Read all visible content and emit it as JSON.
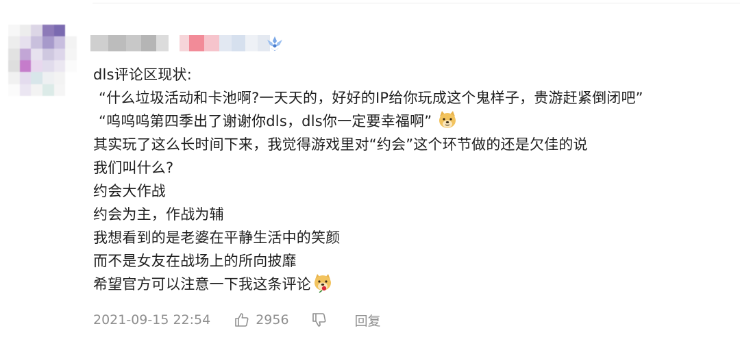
{
  "comment": {
    "lines": [
      "dls评论区现状:",
      "“什么垃圾活动和卡池啊?一天天的，好好的IP给你玩成这个鬼样子，贵游赶紧倒闭吧”",
      "“呜呜呜第四季出了谢谢你dls，dls你一定要幸福啊”",
      "其实玩了这么长时间下来，我觉得游戏里对“约会”这个环节做的还是欠佳的说",
      "我们叫什么?",
      "约会大作战",
      "约会为主，作战为辅",
      "我想看到的是老婆在平静生活中的笑颜",
      "而不是女友在战场上的所向披靡",
      "希望官方可以注意一下我这条评论"
    ]
  },
  "meta": {
    "timestamp": "2021-09-15 22:54",
    "like_count": "2956",
    "reply_label": "回复"
  },
  "icons": {
    "badge": "level-badge-icon",
    "emoji_1": "doge-emoji-icon",
    "emoji_2": "doge-rose-emoji-icon",
    "like": "thumbs-up-icon",
    "dislike": "thumbs-down-icon"
  },
  "colors": {
    "text": "#1f1f1f",
    "meta_text": "#8f8f8f",
    "badge": "#7aa7e6"
  }
}
